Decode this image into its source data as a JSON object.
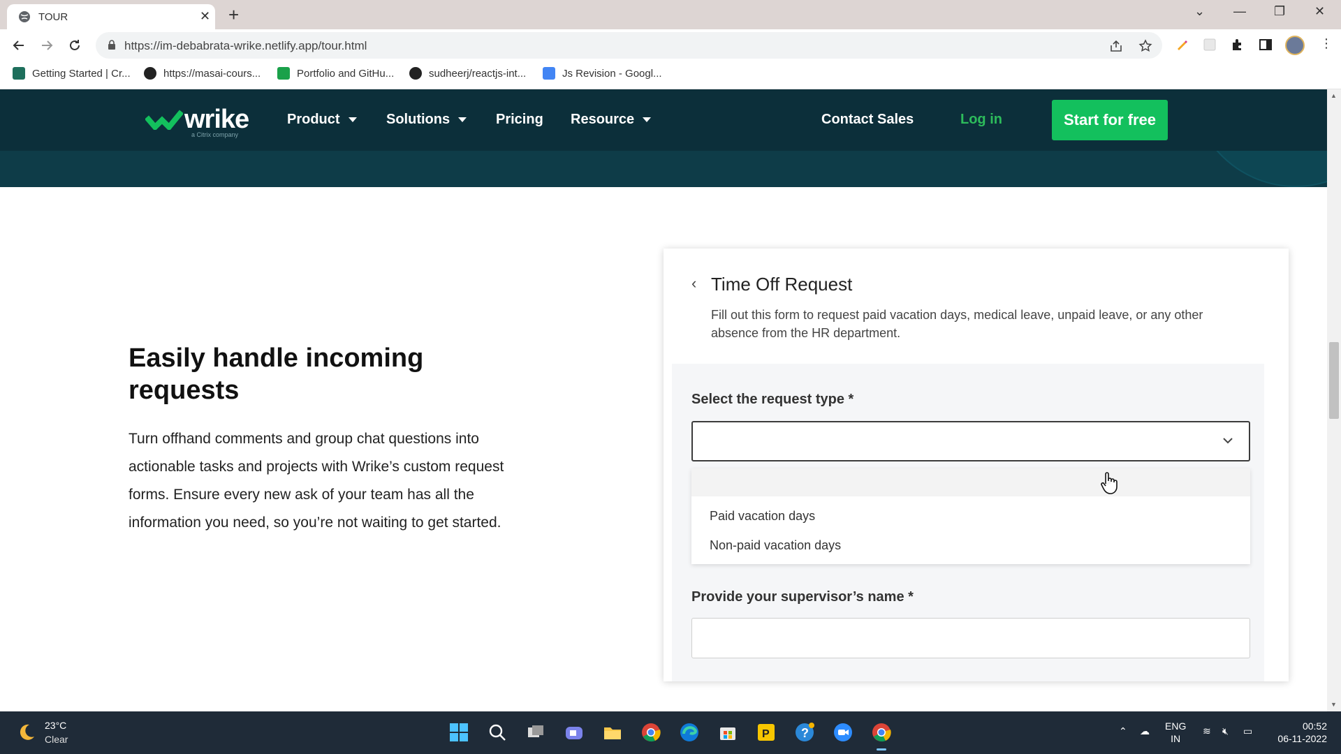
{
  "browser": {
    "tab_title": "TOUR",
    "url": "https://im-debabrata-wrike.netlify.app/tour.html",
    "bookmarks": [
      {
        "label": "Getting Started | Cr...",
        "color": "#1e6f5c"
      },
      {
        "label": "https://masai-cours...",
        "color": "#222222"
      },
      {
        "label": "Portfolio and GitHu...",
        "color": "#1aa14a"
      },
      {
        "label": "sudheerj/reactjs-int...",
        "color": "#222222"
      },
      {
        "label": "Js Revision - Googl...",
        "color": "#4285f4"
      }
    ]
  },
  "site": {
    "logo_text": "wrike",
    "logo_sub": "a Citrix company",
    "nav": {
      "product": "Product",
      "solutions": "Solutions",
      "pricing": "Pricing",
      "resource": "Resource",
      "contact": "Contact Sales",
      "login": "Log in",
      "cta": "Start for free"
    },
    "colors": {
      "header": "#0c2f3a",
      "accent": "#13c05d"
    }
  },
  "section": {
    "headline": "Easily handle incoming requests",
    "body": "Turn offhand comments and group chat questions into actionable tasks and projects with Wrike’s custom request forms. Ensure every new ask of your team has all the information you need, so you’re not waiting to get started."
  },
  "form": {
    "title": "Time Off Request",
    "description": "Fill out this form to request paid vacation days, medical leave, unpaid leave, or any other absence from the HR department.",
    "request_type_label": "Select the request type *",
    "request_type_value": "",
    "options": [
      "",
      "Paid vacation days",
      "Non-paid vacation days"
    ],
    "supervisor_label": "Provide your supervisor’s name *",
    "supervisor_value": ""
  },
  "taskbar": {
    "weather_temp": "23°C",
    "weather_cond": "Clear",
    "lang_line1": "ENG",
    "lang_line2": "IN",
    "time": "00:52",
    "date": "06-11-2022"
  }
}
